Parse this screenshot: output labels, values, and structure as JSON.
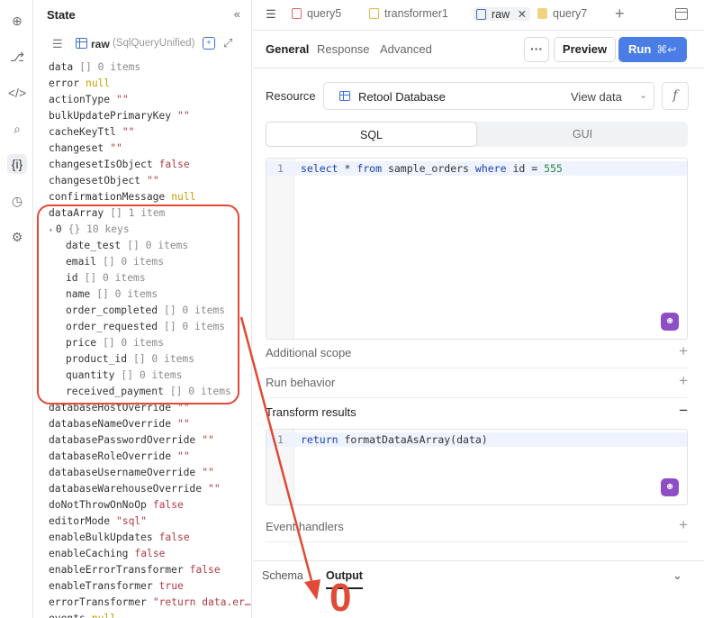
{
  "rail": {
    "icons": [
      "add-icon",
      "flow-icon",
      "code-icon",
      "search-icon",
      "state-icon",
      "history-icon",
      "settings-icon"
    ]
  },
  "state": {
    "title": "State",
    "collapse": "«",
    "query_name": "raw",
    "query_type": "(SqlQueryUnified)",
    "tree": [
      {
        "key": "data",
        "meta": "[] 0 items"
      },
      {
        "key": "error",
        "val": "null",
        "kind": "n"
      },
      {
        "key": "actionType",
        "val": "\"\"",
        "kind": "s"
      },
      {
        "key": "bulkUpdatePrimaryKey",
        "val": "\"\"",
        "kind": "s"
      },
      {
        "key": "cacheKeyTtl",
        "val": "\"\"",
        "kind": "s"
      },
      {
        "key": "changeset",
        "val": "\"\"",
        "kind": "s"
      },
      {
        "key": "changesetIsObject",
        "val": "false",
        "kind": "b"
      },
      {
        "key": "changesetObject",
        "val": "\"\"",
        "kind": "s"
      },
      {
        "key": "confirmationMessage",
        "val": "null",
        "kind": "n"
      },
      {
        "key": "dataArray",
        "meta": "[] 1 item"
      },
      {
        "key": "0",
        "meta": "{} 10 keys",
        "caret": "▾"
      },
      {
        "key": "date_test",
        "meta": "[] 0 items",
        "indent": true
      },
      {
        "key": "email",
        "meta": "[] 0 items",
        "indent": true
      },
      {
        "key": "id",
        "meta": "[] 0 items",
        "indent": true
      },
      {
        "key": "name",
        "meta": "[] 0 items",
        "indent": true
      },
      {
        "key": "order_completed",
        "meta": "[] 0 items",
        "indent": true
      },
      {
        "key": "order_requested",
        "meta": "[] 0 items",
        "indent": true
      },
      {
        "key": "price",
        "meta": "[] 0 items",
        "indent": true
      },
      {
        "key": "product_id",
        "meta": "[] 0 items",
        "indent": true
      },
      {
        "key": "quantity",
        "meta": "[] 0 items",
        "indent": true
      },
      {
        "key": "received_payment",
        "meta": "[] 0 items",
        "indent": true
      },
      {
        "key": "databaseHostOverride",
        "val": "\"\"",
        "kind": "s"
      },
      {
        "key": "databaseNameOverride",
        "val": "\"\"",
        "kind": "s"
      },
      {
        "key": "databasePasswordOverride",
        "val": "\"\"",
        "kind": "s"
      },
      {
        "key": "databaseRoleOverride",
        "val": "\"\"",
        "kind": "s"
      },
      {
        "key": "databaseUsernameOverride",
        "val": "\"\"",
        "kind": "s"
      },
      {
        "key": "databaseWarehouseOverride",
        "val": "\"\"",
        "kind": "s"
      },
      {
        "key": "doNotThrowOnNoOp",
        "val": "false",
        "kind": "b"
      },
      {
        "key": "editorMode",
        "val": "\"sql\"",
        "kind": "s"
      },
      {
        "key": "enableBulkUpdates",
        "val": "false",
        "kind": "b"
      },
      {
        "key": "enableCaching",
        "val": "false",
        "kind": "b"
      },
      {
        "key": "enableErrorTransformer",
        "val": "false",
        "kind": "b"
      },
      {
        "key": "enableTransformer",
        "val": "true",
        "kind": "b"
      },
      {
        "key": "errorTransformer",
        "val": "\"return data.er…",
        "kind": "s"
      },
      {
        "key": "events",
        "val": "null",
        "kind": "n"
      }
    ]
  },
  "tabs": [
    {
      "label": "query5",
      "icon": "query-icon",
      "color": "#e06b6b"
    },
    {
      "label": "transformer1",
      "icon": "transformer-icon",
      "color": "#e8b84a"
    },
    {
      "label": "raw",
      "icon": "table-icon",
      "color": "#3b6fd8",
      "active": true,
      "close": "✕"
    },
    {
      "label": "query7",
      "icon": "js-icon",
      "color": "#e8b84a"
    }
  ],
  "subtabs": [
    "General",
    "Response",
    "Advanced"
  ],
  "toolbar": {
    "more": "···",
    "preview": "Preview",
    "run": "Run",
    "run_shortcut": "⌘↩"
  },
  "resource": {
    "label": "Resource",
    "name": "Retool Database",
    "view": "View data",
    "fx": "f"
  },
  "mode": {
    "options": [
      "SQL",
      "GUI"
    ],
    "selected": "SQL"
  },
  "sql_editor": {
    "line": "1"
  },
  "sections": {
    "additional_scope": "Additional scope",
    "run_behavior": "Run behavior",
    "transform_results": "Transform results",
    "event_handlers": "Event handlers"
  },
  "transform_editor": {
    "line": "1",
    "code_fn": "formatDataAsArray(data)",
    "kw": "return"
  },
  "bottom": {
    "schema": "Schema",
    "output": "Output"
  },
  "annotation": {
    "value": "0",
    "color": "#e04a36"
  }
}
